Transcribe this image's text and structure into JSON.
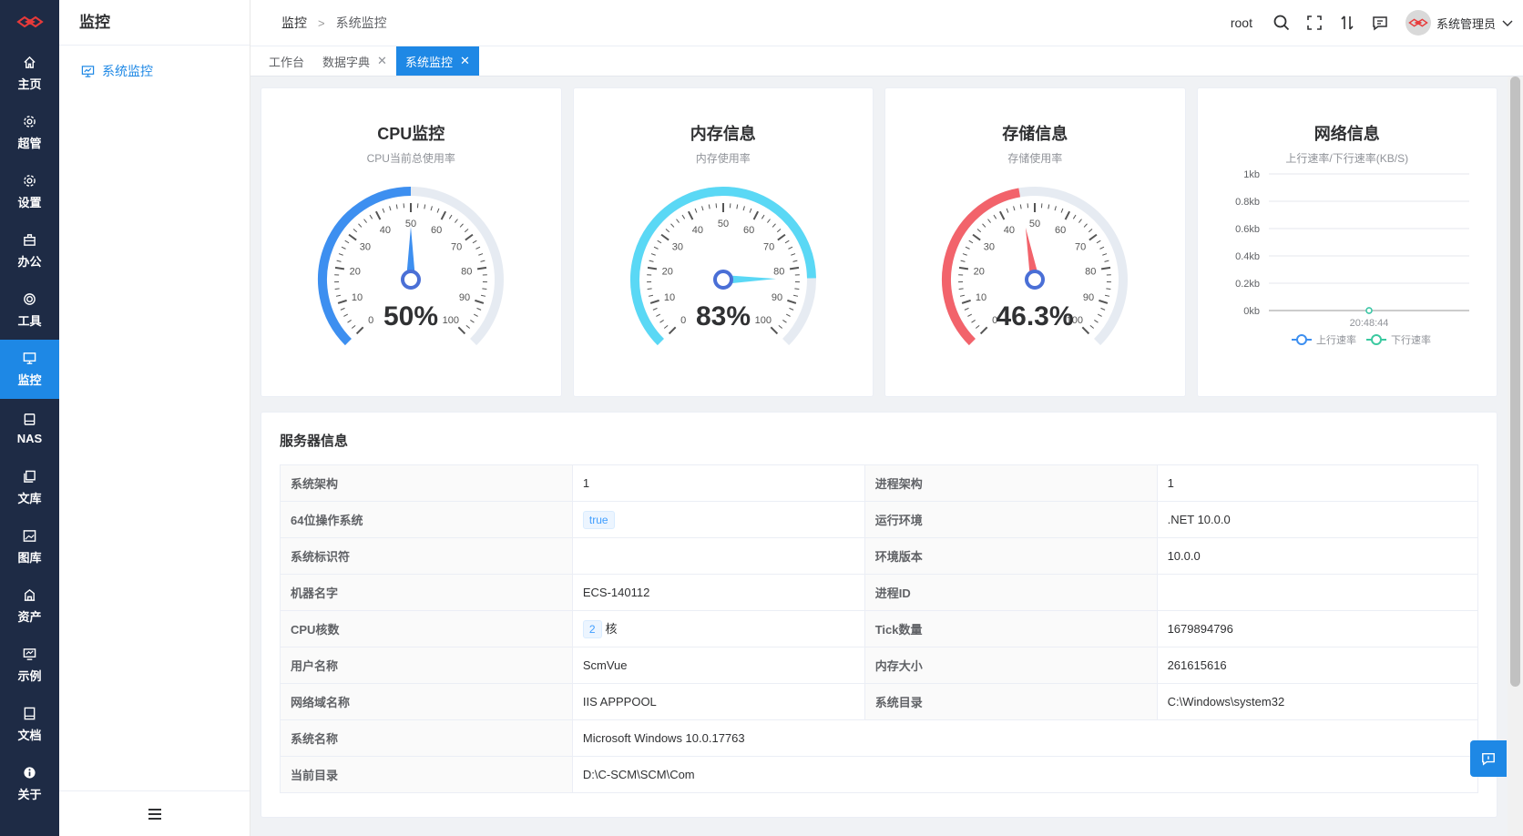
{
  "rail": {
    "items": [
      {
        "label": "主页",
        "icon": "home-icon"
      },
      {
        "label": "超管",
        "icon": "gear-icon"
      },
      {
        "label": "设置",
        "icon": "gear-icon"
      },
      {
        "label": "办公",
        "icon": "briefcase-icon"
      },
      {
        "label": "工具",
        "icon": "tool-icon"
      },
      {
        "label": "监控",
        "icon": "monitor-icon",
        "active": true
      },
      {
        "label": "NAS",
        "icon": "nas-icon"
      },
      {
        "label": "文库",
        "icon": "library-icon"
      },
      {
        "label": "图库",
        "icon": "image-icon"
      },
      {
        "label": "资产",
        "icon": "asset-icon"
      },
      {
        "label": "示例",
        "icon": "example-icon"
      },
      {
        "label": "文档",
        "icon": "doc-icon"
      },
      {
        "label": "关于",
        "icon": "info-icon"
      }
    ]
  },
  "subnav": {
    "title": "监控",
    "item": "系统监控"
  },
  "header": {
    "breadcrumb": [
      "监控",
      "系统监控"
    ],
    "user": "root",
    "account_name": "系统管理员"
  },
  "tabs": [
    {
      "label": "工作台",
      "closable": false
    },
    {
      "label": "数据字典",
      "closable": true
    },
    {
      "label": "系统监控",
      "closable": true,
      "active": true
    }
  ],
  "cards": {
    "cpu": {
      "title": "CPU监控",
      "subtitle": "CPU当前总使用率",
      "value": 50,
      "display": "50%",
      "color": "#3d8ff0"
    },
    "mem": {
      "title": "内存信息",
      "subtitle": "内存使用率",
      "value": 83,
      "display": "83%",
      "color": "#5ad8f5"
    },
    "disk": {
      "title": "存储信息",
      "subtitle": "存储使用率",
      "value": 46.3,
      "display": "46.3%",
      "color": "#f2636b"
    },
    "net": {
      "title": "网络信息",
      "subtitle": "上行速率/下行速率(KB/S)"
    }
  },
  "gauge_ticks": [
    "0",
    "10",
    "20",
    "30",
    "40",
    "50",
    "60",
    "70",
    "80",
    "90",
    "100"
  ],
  "chart_data": {
    "type": "line",
    "x": [
      "20:48:44"
    ],
    "series": [
      {
        "name": "上行速率",
        "values": [
          0
        ],
        "color": "#3d8ff0"
      },
      {
        "name": "下行速率",
        "values": [
          0
        ],
        "color": "#3bc9a0"
      }
    ],
    "yticks": [
      "1kb",
      "0.8kb",
      "0.6kb",
      "0.4kb",
      "0.2kb",
      "0kb"
    ],
    "ylim": [
      0,
      1
    ],
    "legend": "bottom"
  },
  "server": {
    "title": "服务器信息",
    "rows": [
      {
        "k1": "系统架构",
        "v1": "1",
        "k2": "进程架构",
        "v2": "1"
      },
      {
        "k1": "64位操作系统",
        "v1": "true",
        "v1_tag": true,
        "k2": "运行环境",
        "v2": ".NET 10.0.0"
      },
      {
        "k1": "系统标识符",
        "v1": "",
        "k2": "环境版本",
        "v2": "10.0.0"
      },
      {
        "k1": "机器名字",
        "v1": "ECS-140112",
        "k2": "进程ID",
        "v2": ""
      },
      {
        "k1": "CPU核数",
        "v1": "2",
        "v1_tag": true,
        "v1_suffix": "核",
        "k2": "Tick数量",
        "v2": "1679894796"
      },
      {
        "k1": "用户名称",
        "v1": "ScmVue",
        "k2": "内存大小",
        "v2": "261615616"
      },
      {
        "k1": "网络域名称",
        "v1": "IIS APPPOOL",
        "k2": "系统目录",
        "v2": "C:\\Windows\\system32"
      },
      {
        "k1": "系统名称",
        "v1": "Microsoft Windows 10.0.17763",
        "full": true
      },
      {
        "k1": "当前目录",
        "v1": "D:\\C-SCM\\SCM\\Com",
        "full": true
      }
    ]
  }
}
